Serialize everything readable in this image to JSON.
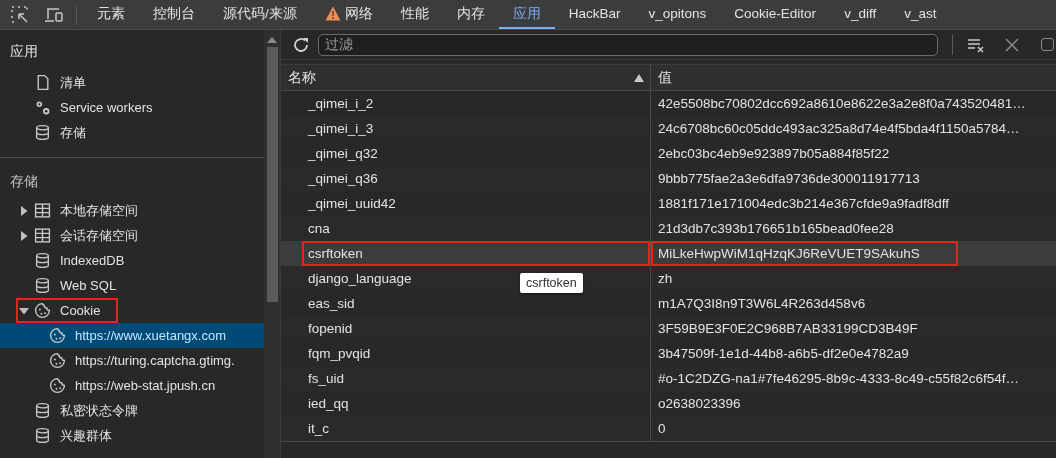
{
  "devtools_tabs": [
    {
      "label": "元素",
      "selected": false,
      "warning": false
    },
    {
      "label": "控制台",
      "selected": false,
      "warning": false
    },
    {
      "label": "源代码/来源",
      "selected": false,
      "warning": false
    },
    {
      "label": "网络",
      "selected": false,
      "warning": true
    },
    {
      "label": "性能",
      "selected": false,
      "warning": false
    },
    {
      "label": "内存",
      "selected": false,
      "warning": false
    },
    {
      "label": "应用",
      "selected": true,
      "warning": false
    },
    {
      "label": "HackBar",
      "selected": false,
      "warning": false
    },
    {
      "label": "v_opitons",
      "selected": false,
      "warning": false
    },
    {
      "label": "Cookie-Editor",
      "selected": false,
      "warning": false
    },
    {
      "label": "v_diff",
      "selected": false,
      "warning": false
    },
    {
      "label": "v_ast",
      "selected": false,
      "warning": false
    }
  ],
  "sidebar": {
    "sections": [
      {
        "title": "应用",
        "items": [
          {
            "label": "清单",
            "kind": "document",
            "selected": false,
            "highlighted": false
          },
          {
            "label": "Service workers",
            "kind": "gears",
            "selected": false,
            "highlighted": false
          },
          {
            "label": "存储",
            "kind": "database",
            "selected": false,
            "highlighted": false
          }
        ]
      },
      {
        "title": "存储",
        "items": [
          {
            "label": "本地存储空间",
            "kind": "grid",
            "expanded": false,
            "selected": false,
            "highlighted": false
          },
          {
            "label": "会话存储空间",
            "kind": "grid",
            "expanded": false,
            "selected": false,
            "highlighted": false
          },
          {
            "label": "IndexedDB",
            "kind": "database",
            "selected": false,
            "highlighted": false
          },
          {
            "label": "Web SQL",
            "kind": "database",
            "selected": false,
            "highlighted": false
          },
          {
            "label": "Cookie",
            "kind": "cookie",
            "expanded": true,
            "selected": false,
            "highlighted": true,
            "children": [
              {
                "label": "https://www.xuetangx.com",
                "kind": "cookie",
                "selected": true,
                "highlighted": false
              },
              {
                "label": "https://turing.captcha.gtimg.",
                "kind": "cookie",
                "selected": false,
                "highlighted": false
              },
              {
                "label": "https://web-stat.jpush.cn",
                "kind": "cookie",
                "selected": false,
                "highlighted": false
              }
            ]
          },
          {
            "label": "私密状态令牌",
            "kind": "database",
            "selected": false,
            "highlighted": false
          },
          {
            "label": "兴趣群体",
            "kind": "database",
            "selected": false,
            "highlighted": false
          }
        ]
      }
    ]
  },
  "toolbar": {
    "filter": {
      "placeholder": "过滤"
    },
    "checkbox": {
      "checked": false
    }
  },
  "table": {
    "columns": [
      {
        "label": "名称",
        "sorted": true
      },
      {
        "label": "值",
        "sorted": false
      }
    ],
    "rows": [
      {
        "name": "_qimei_i_2",
        "value": "42e5508bc70802dcc692a8610e8622e3a2e8f0a743520481…",
        "selected": false,
        "highlighted": false
      },
      {
        "name": "_qimei_i_3",
        "value": "24c6708bc60c05ddc493ac325a8d74e4f5bda4f1150a5784…",
        "selected": false,
        "highlighted": false
      },
      {
        "name": "_qimei_q32",
        "value": "2ebc03bc4eb9e923897b05a884f85f22",
        "selected": false,
        "highlighted": false
      },
      {
        "name": "_qimei_q36",
        "value": "9bbb775fae2a3e6dfa9736de300011917713",
        "selected": false,
        "highlighted": false
      },
      {
        "name": "_qimei_uuid42",
        "value": "1881f171e171004edc3b214e367cfde9a9fadf8dff",
        "selected": false,
        "highlighted": false
      },
      {
        "name": "cna",
        "value": "21d3db7c393b176651b165bead0fee28",
        "selected": false,
        "highlighted": false
      },
      {
        "name": "csrftoken",
        "value": "MiLkeHwpWiM1qHzqKJ6ReVUET9SAkuhS",
        "selected": true,
        "highlighted": true
      },
      {
        "name": "django_language",
        "value": "zh",
        "selected": false,
        "highlighted": false
      },
      {
        "name": "eas_sid",
        "value": "m1A7Q3I8n9T3W6L4R263d458v6",
        "selected": false,
        "highlighted": false
      },
      {
        "name": "fopenid",
        "value": "3F59B9E3F0E2C968B7AB33199CD3B49F",
        "selected": false,
        "highlighted": false
      },
      {
        "name": "fqm_pvqid",
        "value": "3b47509f-1e1d-44b8-a6b5-df2e0e4782a9",
        "selected": false,
        "highlighted": false
      },
      {
        "name": "fs_uid",
        "value": "#o-1C2DZG-na1#7fe46295-8b9c-4333-8c49-c55f82c6f54f…",
        "selected": false,
        "highlighted": false
      },
      {
        "name": "ied_qq",
        "value": "o2638023396",
        "selected": false,
        "highlighted": false
      },
      {
        "name": "it_c",
        "value": "0",
        "selected": false,
        "highlighted": false
      }
    ]
  },
  "tooltip": {
    "text": "csrftoken"
  }
}
